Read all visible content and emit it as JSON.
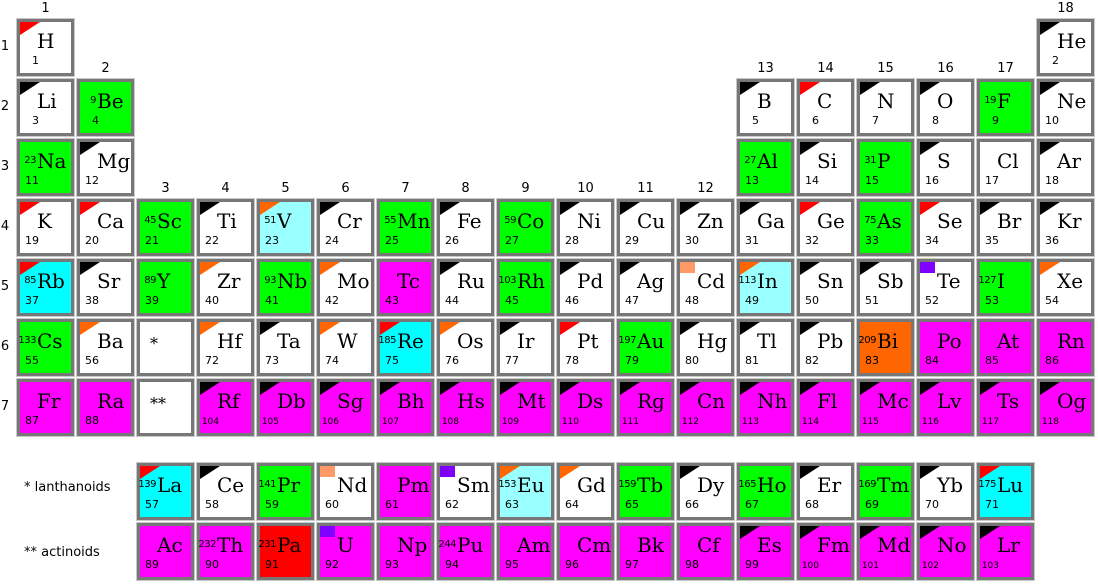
{
  "colors": {
    "white": "#ffffff",
    "green": "#00ff00",
    "cyan": "#00ffff",
    "lightcyan": "#99ffff",
    "magenta": "#ff00ff",
    "orange": "#ff6600",
    "red": "#ff0000",
    "corner_red": "#ff0000",
    "corner_black": "#000000",
    "corner_orange": "#ff6600",
    "square_salmon": "#ff9966",
    "square_purple": "#8000ff",
    "border": "#777777"
  },
  "group_labels": [
    "1",
    "2",
    "3",
    "4",
    "5",
    "6",
    "7",
    "8",
    "9",
    "10",
    "11",
    "12",
    "13",
    "14",
    "15",
    "16",
    "17",
    "18"
  ],
  "period_labels": [
    "1",
    "2",
    "3",
    "4",
    "5",
    "6",
    "7"
  ],
  "series_labels": {
    "lanthanoids": "* lanthanoids",
    "actinoids": "** actinoids"
  },
  "placeholders": [
    {
      "text": "*",
      "group": 3,
      "period": 6
    },
    {
      "text": "**",
      "group": 3,
      "period": 7
    }
  ],
  "elements": [
    {
      "s": "H",
      "n": 1,
      "g": 1,
      "p": 1,
      "bg": "white",
      "corner": "corner_red"
    },
    {
      "s": "He",
      "n": 2,
      "g": 18,
      "p": 1,
      "bg": "white",
      "corner": "corner_black"
    },
    {
      "s": "Li",
      "n": 3,
      "g": 1,
      "p": 2,
      "bg": "white",
      "corner": "corner_black"
    },
    {
      "s": "Be",
      "n": 4,
      "g": 2,
      "p": 2,
      "bg": "green",
      "mass": "9"
    },
    {
      "s": "B",
      "n": 5,
      "g": 13,
      "p": 2,
      "bg": "white",
      "corner": "corner_black"
    },
    {
      "s": "C",
      "n": 6,
      "g": 14,
      "p": 2,
      "bg": "white",
      "corner": "corner_red"
    },
    {
      "s": "N",
      "n": 7,
      "g": 15,
      "p": 2,
      "bg": "white",
      "corner": "corner_black"
    },
    {
      "s": "O",
      "n": 8,
      "g": 16,
      "p": 2,
      "bg": "white",
      "corner": "corner_black"
    },
    {
      "s": "F",
      "n": 9,
      "g": 17,
      "p": 2,
      "bg": "green",
      "mass": "19"
    },
    {
      "s": "Ne",
      "n": 10,
      "g": 18,
      "p": 2,
      "bg": "white",
      "corner": "corner_black"
    },
    {
      "s": "Na",
      "n": 11,
      "g": 1,
      "p": 3,
      "bg": "green",
      "mass": "23"
    },
    {
      "s": "Mg",
      "n": 12,
      "g": 2,
      "p": 3,
      "bg": "white",
      "corner": "corner_black"
    },
    {
      "s": "Al",
      "n": 13,
      "g": 13,
      "p": 3,
      "bg": "green",
      "mass": "27"
    },
    {
      "s": "Si",
      "n": 14,
      "g": 14,
      "p": 3,
      "bg": "white",
      "corner": "corner_black"
    },
    {
      "s": "P",
      "n": 15,
      "g": 15,
      "p": 3,
      "bg": "green",
      "mass": "31"
    },
    {
      "s": "S",
      "n": 16,
      "g": 16,
      "p": 3,
      "bg": "white",
      "corner": "corner_black"
    },
    {
      "s": "Cl",
      "n": 17,
      "g": 17,
      "p": 3,
      "bg": "white"
    },
    {
      "s": "Ar",
      "n": 18,
      "g": 18,
      "p": 3,
      "bg": "white",
      "corner": "corner_black"
    },
    {
      "s": "K",
      "n": 19,
      "g": 1,
      "p": 4,
      "bg": "white",
      "corner": "corner_red"
    },
    {
      "s": "Ca",
      "n": 20,
      "g": 2,
      "p": 4,
      "bg": "white",
      "corner": "corner_red"
    },
    {
      "s": "Sc",
      "n": 21,
      "g": 3,
      "p": 4,
      "bg": "green",
      "mass": "45"
    },
    {
      "s": "Ti",
      "n": 22,
      "g": 4,
      "p": 4,
      "bg": "white",
      "corner": "corner_black"
    },
    {
      "s": "V",
      "n": 23,
      "g": 5,
      "p": 4,
      "bg": "lightcyan",
      "mass": "51",
      "corner": "corner_orange"
    },
    {
      "s": "Cr",
      "n": 24,
      "g": 6,
      "p": 4,
      "bg": "white",
      "corner": "corner_black"
    },
    {
      "s": "Mn",
      "n": 25,
      "g": 7,
      "p": 4,
      "bg": "green",
      "mass": "55"
    },
    {
      "s": "Fe",
      "n": 26,
      "g": 8,
      "p": 4,
      "bg": "white",
      "corner": "corner_black"
    },
    {
      "s": "Co",
      "n": 27,
      "g": 9,
      "p": 4,
      "bg": "green",
      "mass": "59"
    },
    {
      "s": "Ni",
      "n": 28,
      "g": 10,
      "p": 4,
      "bg": "white",
      "corner": "corner_black"
    },
    {
      "s": "Cu",
      "n": 29,
      "g": 11,
      "p": 4,
      "bg": "white",
      "corner": "corner_black"
    },
    {
      "s": "Zn",
      "n": 30,
      "g": 12,
      "p": 4,
      "bg": "white",
      "corner": "corner_black"
    },
    {
      "s": "Ga",
      "n": 31,
      "g": 13,
      "p": 4,
      "bg": "white",
      "corner": "corner_black"
    },
    {
      "s": "Ge",
      "n": 32,
      "g": 14,
      "p": 4,
      "bg": "white",
      "corner": "corner_red"
    },
    {
      "s": "As",
      "n": 33,
      "g": 15,
      "p": 4,
      "bg": "green",
      "mass": "75"
    },
    {
      "s": "Se",
      "n": 34,
      "g": 16,
      "p": 4,
      "bg": "white",
      "corner": "corner_red"
    },
    {
      "s": "Br",
      "n": 35,
      "g": 17,
      "p": 4,
      "bg": "white",
      "corner": "corner_black"
    },
    {
      "s": "Kr",
      "n": 36,
      "g": 18,
      "p": 4,
      "bg": "white",
      "corner": "corner_black"
    },
    {
      "s": "Rb",
      "n": 37,
      "g": 1,
      "p": 5,
      "bg": "cyan",
      "mass": "85",
      "corner": "corner_red"
    },
    {
      "s": "Sr",
      "n": 38,
      "g": 2,
      "p": 5,
      "bg": "white",
      "corner": "corner_black"
    },
    {
      "s": "Y",
      "n": 39,
      "g": 3,
      "p": 5,
      "bg": "green",
      "mass": "89"
    },
    {
      "s": "Zr",
      "n": 40,
      "g": 4,
      "p": 5,
      "bg": "white",
      "corner": "corner_orange"
    },
    {
      "s": "Nb",
      "n": 41,
      "g": 5,
      "p": 5,
      "bg": "green",
      "mass": "93"
    },
    {
      "s": "Mo",
      "n": 42,
      "g": 6,
      "p": 5,
      "bg": "white",
      "corner": "corner_orange"
    },
    {
      "s": "Tc",
      "n": 43,
      "g": 7,
      "p": 5,
      "bg": "magenta"
    },
    {
      "s": "Ru",
      "n": 44,
      "g": 8,
      "p": 5,
      "bg": "white",
      "corner": "corner_black"
    },
    {
      "s": "Rh",
      "n": 45,
      "g": 9,
      "p": 5,
      "bg": "green",
      "mass": "103"
    },
    {
      "s": "Pd",
      "n": 46,
      "g": 10,
      "p": 5,
      "bg": "white",
      "corner": "corner_black"
    },
    {
      "s": "Ag",
      "n": 47,
      "g": 11,
      "p": 5,
      "bg": "white",
      "corner": "corner_black"
    },
    {
      "s": "Cd",
      "n": 48,
      "g": 12,
      "p": 5,
      "bg": "white",
      "square": "square_salmon"
    },
    {
      "s": "In",
      "n": 49,
      "g": 13,
      "p": 5,
      "bg": "lightcyan",
      "mass": "113",
      "corner": "corner_orange"
    },
    {
      "s": "Sn",
      "n": 50,
      "g": 14,
      "p": 5,
      "bg": "white",
      "corner": "corner_black"
    },
    {
      "s": "Sb",
      "n": 51,
      "g": 15,
      "p": 5,
      "bg": "white",
      "corner": "corner_black"
    },
    {
      "s": "Te",
      "n": 52,
      "g": 16,
      "p": 5,
      "bg": "white",
      "square": "square_purple"
    },
    {
      "s": "I",
      "n": 53,
      "g": 17,
      "p": 5,
      "bg": "green",
      "mass": "127"
    },
    {
      "s": "Xe",
      "n": 54,
      "g": 18,
      "p": 5,
      "bg": "white",
      "corner": "corner_orange"
    },
    {
      "s": "Cs",
      "n": 55,
      "g": 1,
      "p": 6,
      "bg": "green",
      "mass": "133"
    },
    {
      "s": "Ba",
      "n": 56,
      "g": 2,
      "p": 6,
      "bg": "white",
      "corner": "corner_orange"
    },
    {
      "s": "Hf",
      "n": 72,
      "g": 4,
      "p": 6,
      "bg": "white",
      "corner": "corner_orange"
    },
    {
      "s": "Ta",
      "n": 73,
      "g": 5,
      "p": 6,
      "bg": "white",
      "corner": "corner_black"
    },
    {
      "s": "W",
      "n": 74,
      "g": 6,
      "p": 6,
      "bg": "white",
      "corner": "corner_orange"
    },
    {
      "s": "Re",
      "n": 75,
      "g": 7,
      "p": 6,
      "bg": "cyan",
      "mass": "185",
      "corner": "corner_red"
    },
    {
      "s": "Os",
      "n": 76,
      "g": 8,
      "p": 6,
      "bg": "white",
      "corner": "corner_orange"
    },
    {
      "s": "Ir",
      "n": 77,
      "g": 9,
      "p": 6,
      "bg": "white",
      "corner": "corner_black"
    },
    {
      "s": "Pt",
      "n": 78,
      "g": 10,
      "p": 6,
      "bg": "white",
      "corner": "corner_red"
    },
    {
      "s": "Au",
      "n": 79,
      "g": 11,
      "p": 6,
      "bg": "green",
      "mass": "197"
    },
    {
      "s": "Hg",
      "n": 80,
      "g": 12,
      "p": 6,
      "bg": "white",
      "corner": "corner_black"
    },
    {
      "s": "Tl",
      "n": 81,
      "g": 13,
      "p": 6,
      "bg": "white",
      "corner": "corner_black"
    },
    {
      "s": "Pb",
      "n": 82,
      "g": 14,
      "p": 6,
      "bg": "white",
      "corner": "corner_black"
    },
    {
      "s": "Bi",
      "n": 83,
      "g": 15,
      "p": 6,
      "bg": "orange",
      "mass": "209"
    },
    {
      "s": "Po",
      "n": 84,
      "g": 16,
      "p": 6,
      "bg": "magenta"
    },
    {
      "s": "At",
      "n": 85,
      "g": 17,
      "p": 6,
      "bg": "magenta"
    },
    {
      "s": "Rn",
      "n": 86,
      "g": 18,
      "p": 6,
      "bg": "magenta"
    },
    {
      "s": "Fr",
      "n": 87,
      "g": 1,
      "p": 7,
      "bg": "magenta"
    },
    {
      "s": "Ra",
      "n": 88,
      "g": 2,
      "p": 7,
      "bg": "magenta"
    },
    {
      "s": "Rf",
      "n": 104,
      "g": 4,
      "p": 7,
      "bg": "magenta",
      "corner": "corner_black"
    },
    {
      "s": "Db",
      "n": 105,
      "g": 5,
      "p": 7,
      "bg": "magenta",
      "corner": "corner_black"
    },
    {
      "s": "Sg",
      "n": 106,
      "g": 6,
      "p": 7,
      "bg": "magenta",
      "corner": "corner_black"
    },
    {
      "s": "Bh",
      "n": 107,
      "g": 7,
      "p": 7,
      "bg": "magenta",
      "corner": "corner_black"
    },
    {
      "s": "Hs",
      "n": 108,
      "g": 8,
      "p": 7,
      "bg": "magenta",
      "corner": "corner_black"
    },
    {
      "s": "Mt",
      "n": 109,
      "g": 9,
      "p": 7,
      "bg": "magenta",
      "corner": "corner_black"
    },
    {
      "s": "Ds",
      "n": 110,
      "g": 10,
      "p": 7,
      "bg": "magenta",
      "corner": "corner_black"
    },
    {
      "s": "Rg",
      "n": 111,
      "g": 11,
      "p": 7,
      "bg": "magenta",
      "corner": "corner_black"
    },
    {
      "s": "Cn",
      "n": 112,
      "g": 12,
      "p": 7,
      "bg": "magenta",
      "corner": "corner_black"
    },
    {
      "s": "Nh",
      "n": 113,
      "g": 13,
      "p": 7,
      "bg": "magenta",
      "corner": "corner_black"
    },
    {
      "s": "Fl",
      "n": 114,
      "g": 14,
      "p": 7,
      "bg": "magenta",
      "corner": "corner_black"
    },
    {
      "s": "Mc",
      "n": 115,
      "g": 15,
      "p": 7,
      "bg": "magenta",
      "corner": "corner_black"
    },
    {
      "s": "Lv",
      "n": 116,
      "g": 16,
      "p": 7,
      "bg": "magenta",
      "corner": "corner_black"
    },
    {
      "s": "Ts",
      "n": 117,
      "g": 17,
      "p": 7,
      "bg": "magenta",
      "corner": "corner_black"
    },
    {
      "s": "Og",
      "n": 118,
      "g": 18,
      "p": 7,
      "bg": "magenta",
      "corner": "corner_black"
    },
    {
      "s": "La",
      "n": 57,
      "series": "lanthanoids",
      "bg": "cyan",
      "mass": "139",
      "corner": "corner_red"
    },
    {
      "s": "Ce",
      "n": 58,
      "series": "lanthanoids",
      "bg": "white",
      "corner": "corner_black"
    },
    {
      "s": "Pr",
      "n": 59,
      "series": "lanthanoids",
      "bg": "green",
      "mass": "141"
    },
    {
      "s": "Nd",
      "n": 60,
      "series": "lanthanoids",
      "bg": "white",
      "square": "square_salmon"
    },
    {
      "s": "Pm",
      "n": 61,
      "series": "lanthanoids",
      "bg": "magenta"
    },
    {
      "s": "Sm",
      "n": 62,
      "series": "lanthanoids",
      "bg": "white",
      "square": "square_purple"
    },
    {
      "s": "Eu",
      "n": 63,
      "series": "lanthanoids",
      "bg": "lightcyan",
      "mass": "153",
      "corner": "corner_orange"
    },
    {
      "s": "Gd",
      "n": 64,
      "series": "lanthanoids",
      "bg": "white",
      "corner": "corner_orange"
    },
    {
      "s": "Tb",
      "n": 65,
      "series": "lanthanoids",
      "bg": "green",
      "mass": "159"
    },
    {
      "s": "Dy",
      "n": 66,
      "series": "lanthanoids",
      "bg": "white",
      "corner": "corner_black"
    },
    {
      "s": "Ho",
      "n": 67,
      "series": "lanthanoids",
      "bg": "green",
      "mass": "165"
    },
    {
      "s": "Er",
      "n": 68,
      "series": "lanthanoids",
      "bg": "white",
      "corner": "corner_black"
    },
    {
      "s": "Tm",
      "n": 69,
      "series": "lanthanoids",
      "bg": "green",
      "mass": "169"
    },
    {
      "s": "Yb",
      "n": 70,
      "series": "lanthanoids",
      "bg": "white",
      "corner": "corner_black"
    },
    {
      "s": "Lu",
      "n": 71,
      "series": "lanthanoids",
      "bg": "cyan",
      "mass": "175",
      "corner": "corner_red"
    },
    {
      "s": "Ac",
      "n": 89,
      "series": "actinoids",
      "bg": "magenta"
    },
    {
      "s": "Th",
      "n": 90,
      "series": "actinoids",
      "bg": "magenta",
      "mass": "232"
    },
    {
      "s": "Pa",
      "n": 91,
      "series": "actinoids",
      "bg": "red",
      "mass": "231"
    },
    {
      "s": "U",
      "n": 92,
      "series": "actinoids",
      "bg": "magenta",
      "square": "square_purple"
    },
    {
      "s": "Np",
      "n": 93,
      "series": "actinoids",
      "bg": "magenta"
    },
    {
      "s": "Pu",
      "n": 94,
      "series": "actinoids",
      "bg": "magenta",
      "mass": "244"
    },
    {
      "s": "Am",
      "n": 95,
      "series": "actinoids",
      "bg": "magenta"
    },
    {
      "s": "Cm",
      "n": 96,
      "series": "actinoids",
      "bg": "magenta"
    },
    {
      "s": "Bk",
      "n": 97,
      "series": "actinoids",
      "bg": "magenta"
    },
    {
      "s": "Cf",
      "n": 98,
      "series": "actinoids",
      "bg": "magenta"
    },
    {
      "s": "Es",
      "n": 99,
      "series": "actinoids",
      "bg": "magenta",
      "corner": "corner_black"
    },
    {
      "s": "Fm",
      "n": 100,
      "series": "actinoids",
      "bg": "magenta",
      "corner": "corner_black"
    },
    {
      "s": "Md",
      "n": 101,
      "series": "actinoids",
      "bg": "magenta",
      "corner": "corner_black"
    },
    {
      "s": "No",
      "n": 102,
      "series": "actinoids",
      "bg": "magenta",
      "corner": "corner_black"
    },
    {
      "s": "Lr",
      "n": 103,
      "series": "actinoids",
      "bg": "magenta",
      "corner": "corner_black"
    }
  ]
}
